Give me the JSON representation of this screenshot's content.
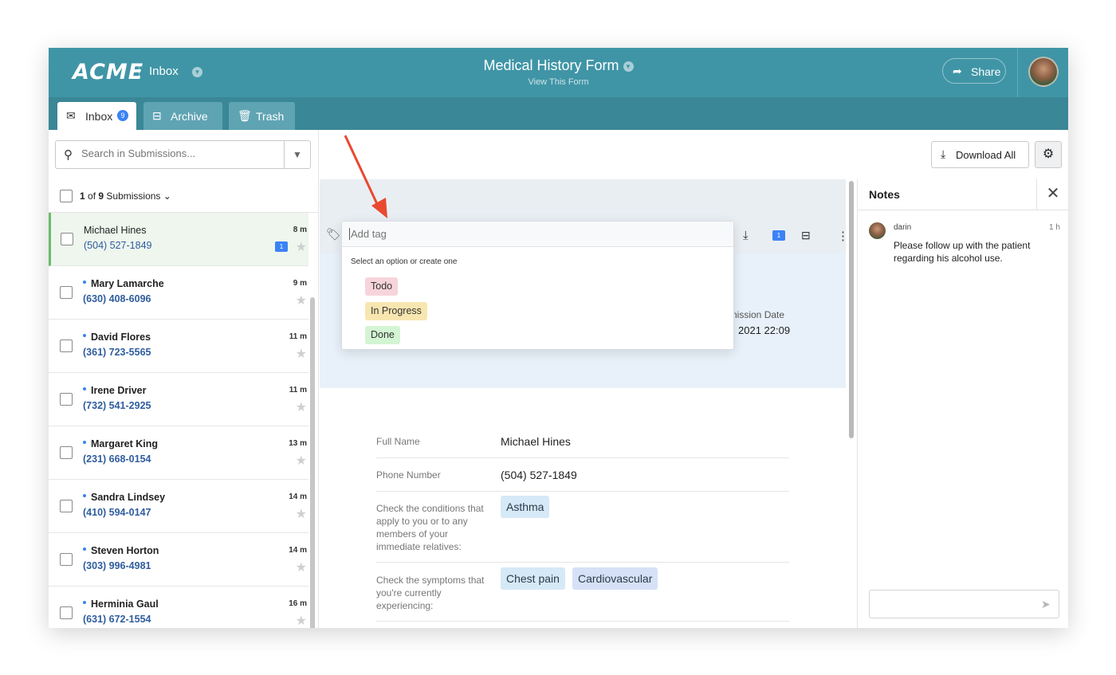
{
  "app": {
    "logo": "ACME",
    "section": "Inbox",
    "form_title": "Medical History Form",
    "form_subtitle": "View This Form",
    "share_label": "Share"
  },
  "tabs": [
    {
      "label": "Inbox",
      "badge": "9",
      "icon": "envelope-icon"
    },
    {
      "label": "Archive",
      "icon": "archive-tray-icon"
    },
    {
      "label": "Trash",
      "icon": "trash-icon"
    }
  ],
  "search": {
    "placeholder": "Search in Submissions..."
  },
  "list": {
    "count_prefix": "1",
    "count_middle": " of ",
    "count_total": "9",
    "count_suffix": " Submissions",
    "items": [
      {
        "name": "Michael Hines",
        "phone": "(504) 527-1849",
        "time": "8 m",
        "unread": false,
        "note_count": "1"
      },
      {
        "name": "Mary Lamarche",
        "phone": "(630) 408-6096",
        "time": "9 m",
        "unread": true
      },
      {
        "name": "David Flores",
        "phone": "(361) 723-5565",
        "time": "11 m",
        "unread": true
      },
      {
        "name": "Irene Driver",
        "phone": "(732) 541-2925",
        "time": "11 m",
        "unread": true
      },
      {
        "name": "Margaret King",
        "phone": "(231) 668-0154",
        "time": "13 m",
        "unread": true
      },
      {
        "name": "Sandra Lindsey",
        "phone": "(410) 594-0147",
        "time": "14 m",
        "unread": true
      },
      {
        "name": "Steven Horton",
        "phone": "(303) 996-4981",
        "time": "14 m",
        "unread": true
      },
      {
        "name": "Herminia Gaul",
        "phone": "(631) 672-1554",
        "time": "16 m",
        "unread": true
      }
    ]
  },
  "toolbar": {
    "download_all": "Download All"
  },
  "submission": {
    "note_count": "1",
    "date_label": "nission Date",
    "date_value": "2021 22:09",
    "fields": [
      {
        "label": "Full Name",
        "value": "Michael Hines"
      },
      {
        "label": "Phone Number",
        "value": "(504) 527-1849"
      },
      {
        "label": "Check the conditions that apply to you or to any members of your immediate relatives:",
        "chips": [
          "Asthma"
        ]
      },
      {
        "label": "Check the symptoms that you're currently experiencing:",
        "chips": [
          "Chest pain",
          "Cardiovascular"
        ]
      }
    ]
  },
  "tag_popup": {
    "placeholder": "Add tag",
    "hint": "Select an option or create one",
    "options": [
      {
        "label": "Todo",
        "color": "#f7d4dc"
      },
      {
        "label": "In Progress",
        "color": "#f8e6b0"
      },
      {
        "label": "Done",
        "color": "#d3f5d3"
      }
    ]
  },
  "notes": {
    "title": "Notes",
    "author": "darin",
    "time": "1 h",
    "text": "Please follow up with the patient regarding his alcohol use."
  },
  "colors": {
    "topbar": "#3f95a6",
    "tabbar": "#3a8797",
    "accent_blue": "#3b82f6",
    "arrow": "#e8492f",
    "chip_blue": "#d5e9f7",
    "chip_violet": "#d6e1f7"
  }
}
